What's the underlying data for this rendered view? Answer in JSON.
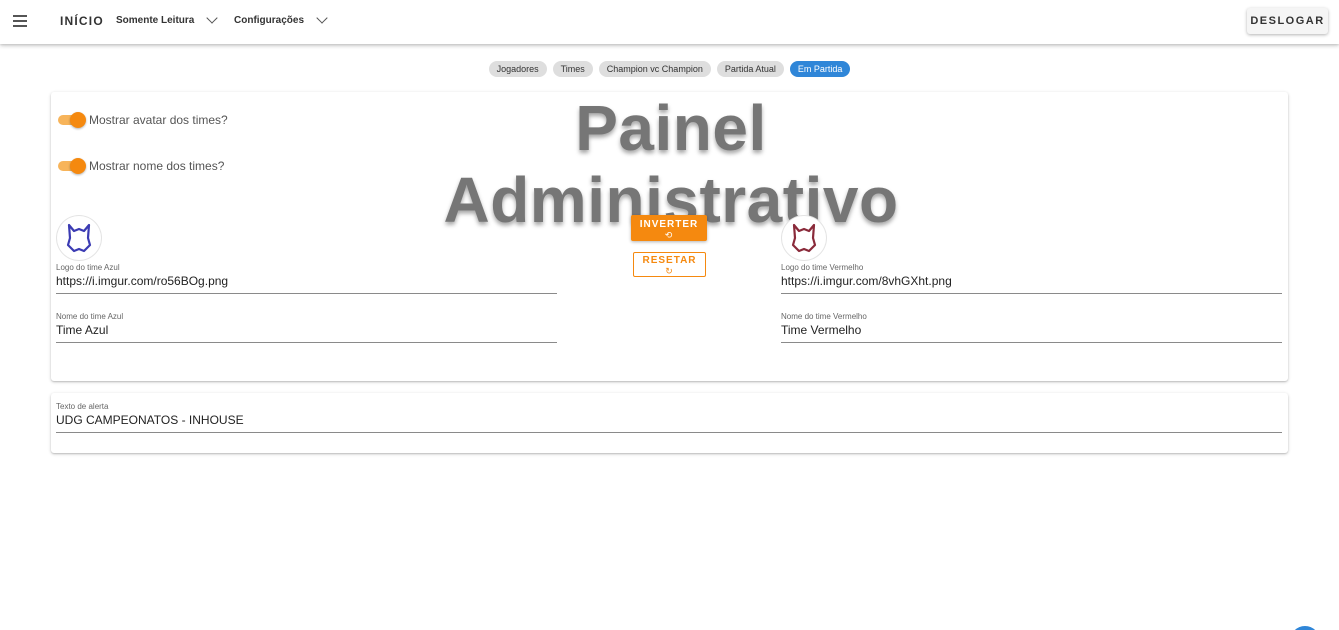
{
  "header": {
    "home_label": "INÍCIO",
    "readonly_label": "Somente Leitura",
    "settings_label": "Configurações",
    "logout_label": "DESLOGAR"
  },
  "tabs": [
    {
      "label": "Jogadores",
      "active": false
    },
    {
      "label": "Times",
      "active": false
    },
    {
      "label": "Champion vc Champion",
      "active": false
    },
    {
      "label": "Partida Atual",
      "active": false
    },
    {
      "label": "Em Partida",
      "active": true
    }
  ],
  "panel": {
    "title": "Painel Administrativo",
    "toggle_avatar_label": "Mostrar avatar dos times?",
    "toggle_avatar_on": true,
    "toggle_name_label": "Mostrar nome dos times?",
    "toggle_name_on": true,
    "invert_label": "INVERTER",
    "reset_label": "RESETAR",
    "blue": {
      "logo_label": "Logo do time Azul",
      "logo_value": "https://i.imgur.com/ro56BOg.png",
      "name_label": "Nome do time Azul",
      "name_value": "Time Azul",
      "color": "#3b3bb3"
    },
    "red": {
      "logo_label": "Logo do time Vermelho",
      "logo_value": "https://i.imgur.com/8vhGXht.png",
      "name_label": "Nome do time Vermelho",
      "name_value": "Time Vermelho",
      "color": "#8a2a3a"
    }
  },
  "alert": {
    "label": "Texto de alerta",
    "value": "UDG CAMPEONATOS - INHOUSE"
  },
  "colors": {
    "accent": "#f5890f",
    "chip_active": "#2f86d8"
  }
}
